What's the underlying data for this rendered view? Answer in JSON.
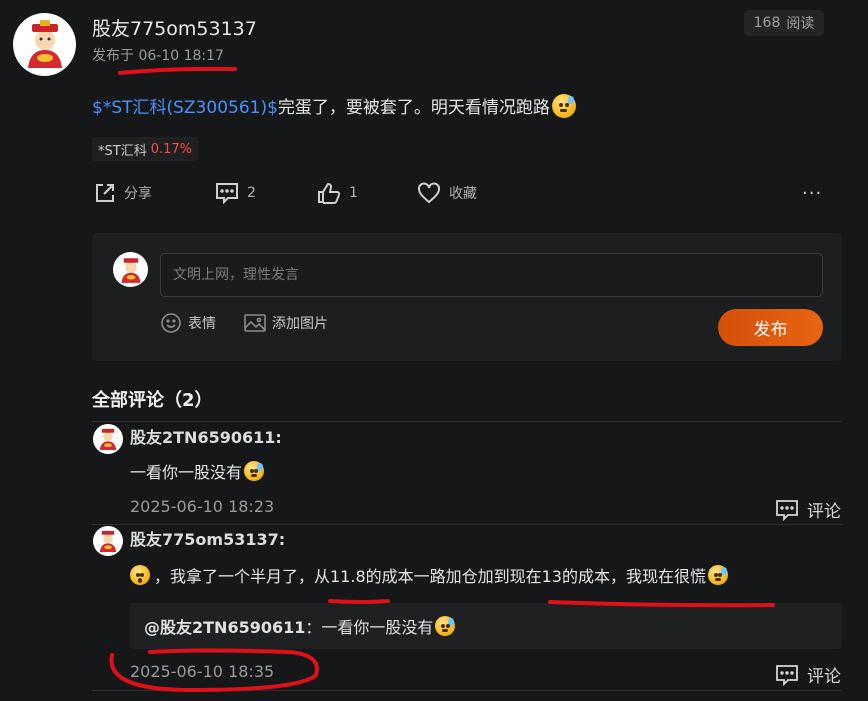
{
  "post": {
    "author": "股友775om53137",
    "time": "发布于 06-10 18:17",
    "read_count": "168",
    "read_label": "阅读",
    "stock_link_text": "$*ST汇科(SZ300561)$",
    "body_text": "完蛋了，要被套了。明天看情况跑路",
    "stock_tag_name": "*ST汇科",
    "stock_tag_change": "0.17%"
  },
  "actions": {
    "share_label": "分享",
    "comment_count": "2",
    "like_count": "1",
    "favorite_label": "收藏",
    "more_label": "···"
  },
  "composer": {
    "placeholder": "文明上网，理性发言",
    "emoji_label": "表情",
    "image_label": "添加图片",
    "publish_label": "发布"
  },
  "comments_header": "全部评论（2）",
  "comments": [
    {
      "user": "股友2TN6590611:",
      "text": "一看你一股没有",
      "time": "2025-06-10 18:23",
      "reply_label": "评论"
    },
    {
      "user": "股友775om53137:",
      "text": "，我拿了一个半月了，从11.8的成本一路加仓加到现在13的成本，我现在很慌",
      "quote_user": "@股友2TN6590611",
      "quote_text": "：一看你一股没有",
      "time": "2025-06-10 18:35",
      "reply_label": "评论"
    }
  ],
  "colors": {
    "background": "#161718",
    "link": "#4a90ff",
    "stock_up": "#ff4d3d",
    "publish_button": "#e0600f",
    "annotation": "#e0101a"
  },
  "icons": [
    "share-icon",
    "comment-icon",
    "like-icon",
    "heart-icon",
    "more-icon",
    "emoji-icon",
    "image-icon",
    "reply-icon"
  ]
}
